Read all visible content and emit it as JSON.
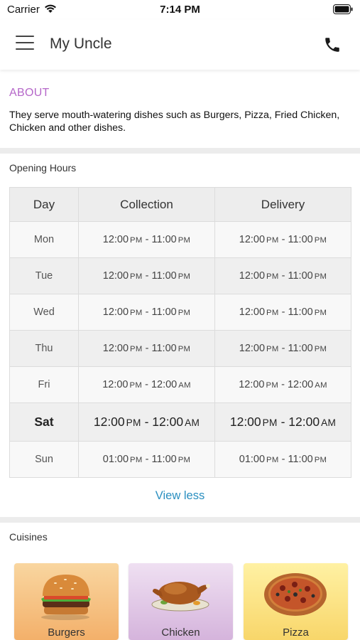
{
  "status_bar": {
    "carrier": "Carrier",
    "time": "7:14 PM"
  },
  "header": {
    "title": "My Uncle",
    "menu_icon": "hamburger-menu-icon",
    "call_icon": "phone-icon"
  },
  "about": {
    "title": "ABOUT",
    "text": "They serve mouth-watering dishes such as Burgers, Pizza, Fried Chicken, Chicken and other dishes."
  },
  "opening_hours": {
    "title": "Opening Hours",
    "columns": [
      "Day",
      "Collection",
      "Delivery"
    ],
    "rows": [
      {
        "day": "Mon",
        "collection": {
          "from": "12:00",
          "from_period": "PM",
          "to": "11:00",
          "to_period": "PM"
        },
        "delivery": {
          "from": "12:00",
          "from_period": "PM",
          "to": "11:00",
          "to_period": "PM"
        }
      },
      {
        "day": "Tue",
        "collection": {
          "from": "12:00",
          "from_period": "PM",
          "to": "11:00",
          "to_period": "PM"
        },
        "delivery": {
          "from": "12:00",
          "from_period": "PM",
          "to": "11:00",
          "to_period": "PM"
        }
      },
      {
        "day": "Wed",
        "collection": {
          "from": "12:00",
          "from_period": "PM",
          "to": "11:00",
          "to_period": "PM"
        },
        "delivery": {
          "from": "12:00",
          "from_period": "PM",
          "to": "11:00",
          "to_period": "PM"
        }
      },
      {
        "day": "Thu",
        "collection": {
          "from": "12:00",
          "from_period": "PM",
          "to": "11:00",
          "to_period": "PM"
        },
        "delivery": {
          "from": "12:00",
          "from_period": "PM",
          "to": "11:00",
          "to_period": "PM"
        }
      },
      {
        "day": "Fri",
        "collection": {
          "from": "12:00",
          "from_period": "PM",
          "to": "12:00",
          "to_period": "AM"
        },
        "delivery": {
          "from": "12:00",
          "from_period": "PM",
          "to": "12:00",
          "to_period": "AM"
        }
      },
      {
        "day": "Sat",
        "today": true,
        "collection": {
          "from": "12:00",
          "from_period": "PM",
          "to": "12:00",
          "to_period": "AM"
        },
        "delivery": {
          "from": "12:00",
          "from_period": "PM",
          "to": "12:00",
          "to_period": "AM"
        }
      },
      {
        "day": "Sun",
        "collection": {
          "from": "01:00",
          "from_period": "PM",
          "to": "11:00",
          "to_period": "PM"
        },
        "delivery": {
          "from": "01:00",
          "from_period": "PM",
          "to": "11:00",
          "to_period": "PM"
        }
      }
    ],
    "toggle_label": "View less"
  },
  "cuisines": {
    "title": "Cuisines",
    "items": [
      {
        "label": "Burgers",
        "icon": "burger-image"
      },
      {
        "label": "Chicken",
        "icon": "roast-chicken-image"
      },
      {
        "label": "Pizza",
        "icon": "pizza-image"
      }
    ]
  },
  "colors": {
    "about_title": "#b567c9",
    "link": "#2a8fc0",
    "divider": "#ececec",
    "table_header": "#ededed"
  }
}
